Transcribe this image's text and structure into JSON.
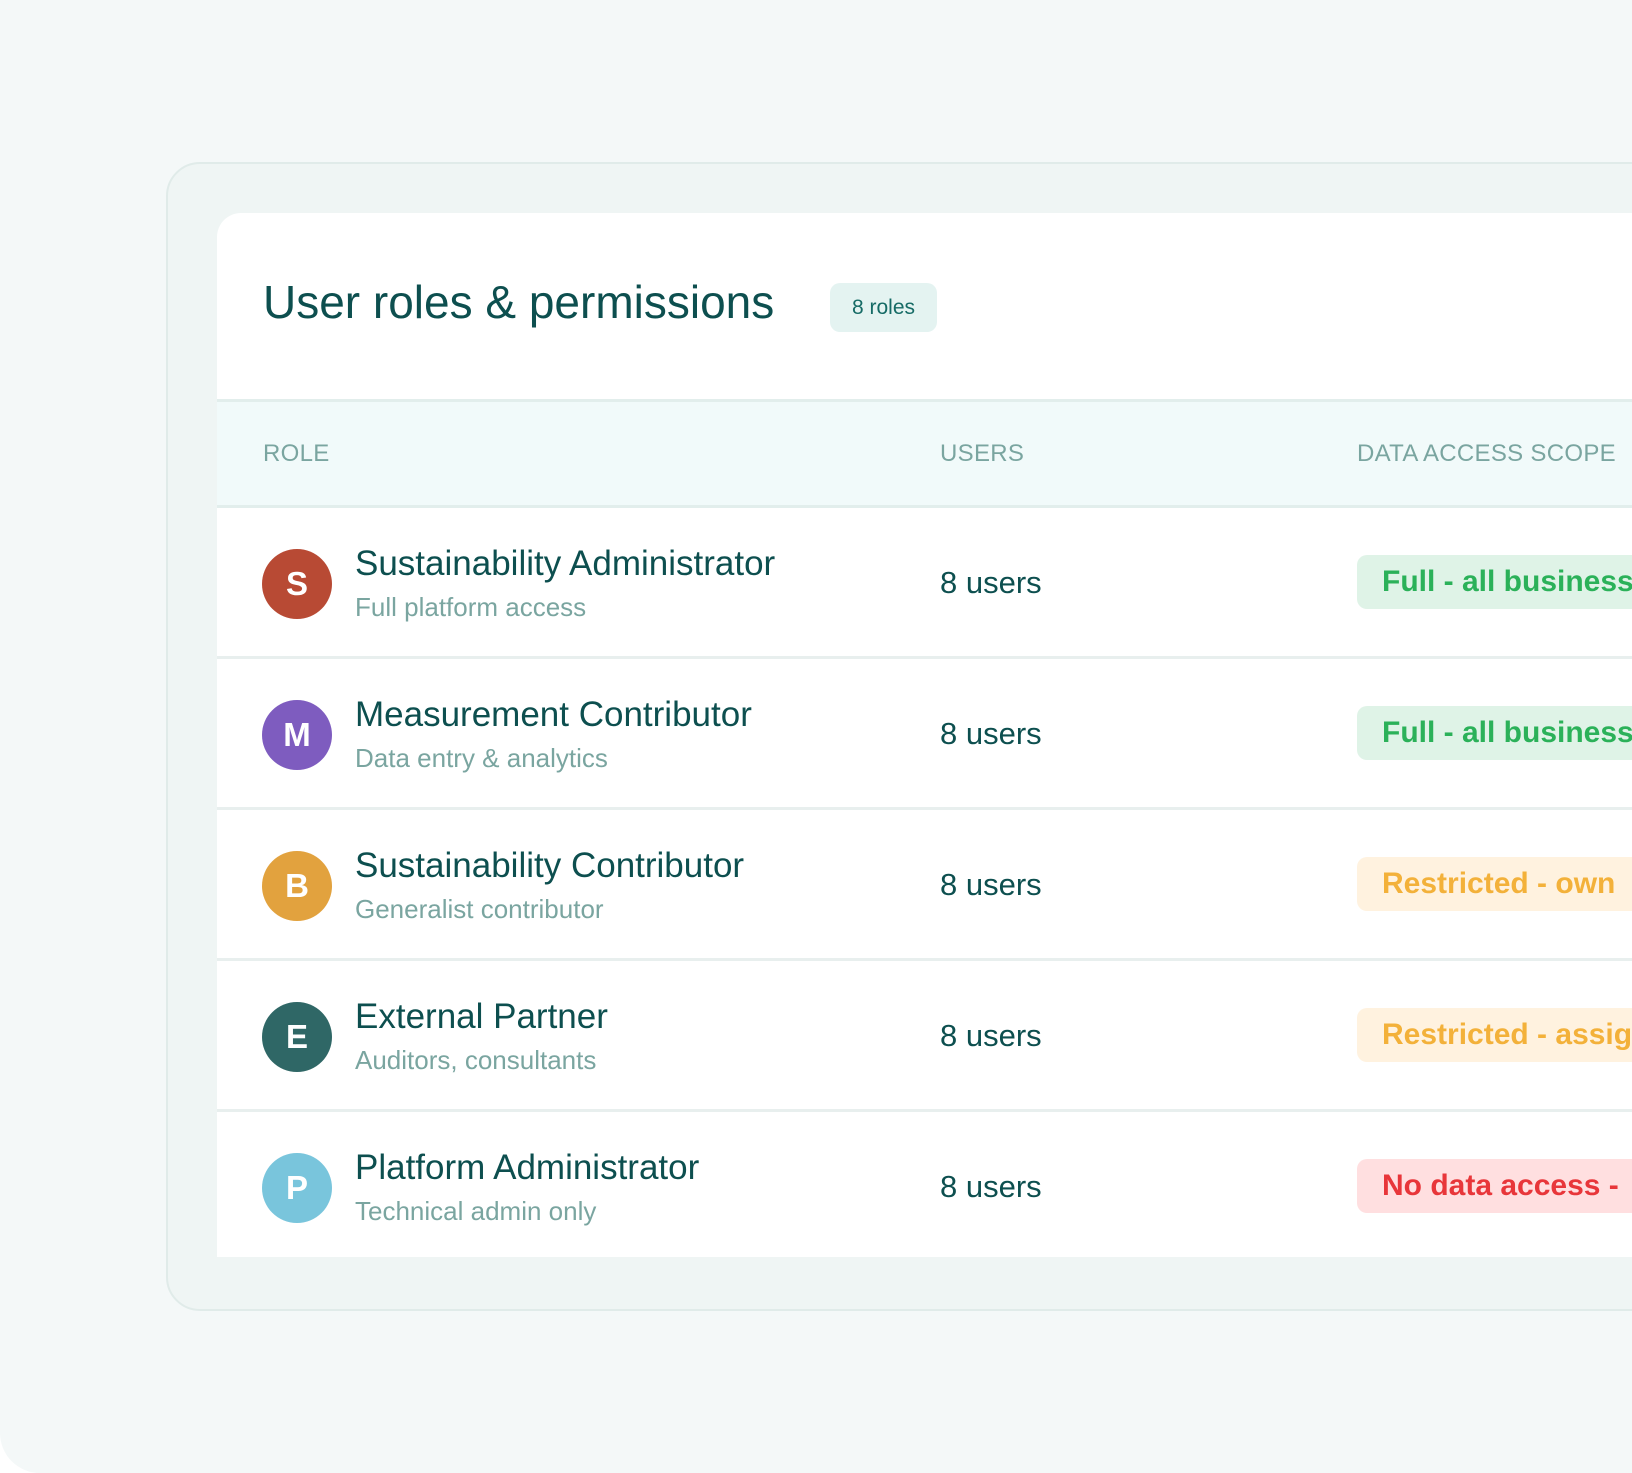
{
  "header": {
    "title": "User roles & permissions",
    "count_badge": "8 roles"
  },
  "table": {
    "columns": [
      "ROLE",
      "USERS",
      "DATA ACCESS SCOPE"
    ],
    "rows": [
      {
        "initial": "S",
        "name": "Sustainability Administrator",
        "description": "Full platform access",
        "users": "8 users",
        "scope": "Full - all business",
        "scope_level": "full",
        "avatar_color": "#b84a34"
      },
      {
        "initial": "M",
        "name": "Measurement Contributor",
        "description": "Data entry & analytics",
        "users": "8 users",
        "scope": "Full - all business",
        "scope_level": "full",
        "avatar_color": "#7e5cbf"
      },
      {
        "initial": "B",
        "name": "Sustainability Contributor",
        "description": "Generalist contributor",
        "users": "8 users",
        "scope": "Restricted - own",
        "scope_level": "restricted",
        "avatar_color": "#e2a23e"
      },
      {
        "initial": "E",
        "name": "External Partner",
        "description": "Auditors, consultants",
        "users": "8 users",
        "scope": "Restricted - assig",
        "scope_level": "restricted",
        "avatar_color": "#2f6766"
      },
      {
        "initial": "P",
        "name": "Platform Administrator",
        "description": "Technical admin only",
        "users": "8 users",
        "scope": "No data access -",
        "scope_level": "none",
        "avatar_color": "#79c5dc"
      }
    ]
  },
  "colors": {
    "primary_text": "#0d4f4f",
    "muted_text": "#7aa5a0",
    "scope_full_bg": "#dff3e7",
    "scope_full_text": "#2bb159",
    "scope_restricted_bg": "#fff2df",
    "scope_restricted_text": "#f3b13a",
    "scope_none_bg": "#ffdfe0",
    "scope_none_text": "#e8363a"
  }
}
